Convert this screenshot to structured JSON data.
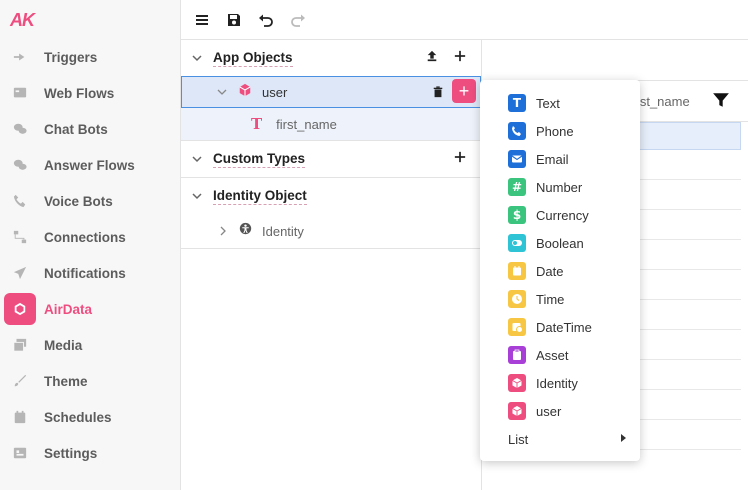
{
  "app": {
    "logo": "AK"
  },
  "sidebar": {
    "items": [
      {
        "label": "Triggers",
        "icon": "triggers-icon"
      },
      {
        "label": "Web Flows",
        "icon": "web-flows-icon"
      },
      {
        "label": "Chat Bots",
        "icon": "chat-bots-icon"
      },
      {
        "label": "Answer Flows",
        "icon": "answer-flows-icon"
      },
      {
        "label": "Voice Bots",
        "icon": "voice-bots-icon"
      },
      {
        "label": "Connections",
        "icon": "connections-icon"
      },
      {
        "label": "Notifications",
        "icon": "notifications-icon"
      },
      {
        "label": "AirData",
        "icon": "airdata-icon",
        "active": true
      },
      {
        "label": "Media",
        "icon": "media-icon"
      },
      {
        "label": "Theme",
        "icon": "theme-icon"
      },
      {
        "label": "Schedules",
        "icon": "schedules-icon"
      },
      {
        "label": "Settings",
        "icon": "settings-icon"
      }
    ]
  },
  "toolbar": {
    "menu_icon": "menu-icon",
    "save_icon": "save-icon",
    "undo_icon": "undo-icon",
    "redo_icon": "redo-icon"
  },
  "tree": {
    "app_objects": {
      "title": "App Objects",
      "user": {
        "label": "user"
      },
      "field": {
        "label": "first_name"
      }
    },
    "custom_types": {
      "title": "Custom Types"
    },
    "identity_object": {
      "title": "Identity Object",
      "identity": {
        "label": "Identity"
      }
    }
  },
  "grid": {
    "column_label": "first_name"
  },
  "type_menu": {
    "items": [
      {
        "label": "Text",
        "color": "#1f6fd9"
      },
      {
        "label": "Phone",
        "color": "#1f6fd9"
      },
      {
        "label": "Email",
        "color": "#1f6fd9"
      },
      {
        "label": "Number",
        "color": "#3ac47d"
      },
      {
        "label": "Currency",
        "color": "#3ac47d"
      },
      {
        "label": "Boolean",
        "color": "#2ec4d6"
      },
      {
        "label": "Date",
        "color": "#f7c744"
      },
      {
        "label": "Time",
        "color": "#f7c744"
      },
      {
        "label": "DateTime",
        "color": "#f7c744"
      },
      {
        "label": "Asset",
        "color": "#a83fd6"
      },
      {
        "label": "Identity",
        "color": "#ee4d80"
      },
      {
        "label": "user",
        "color": "#ee4d80"
      }
    ],
    "list_label": "List"
  }
}
